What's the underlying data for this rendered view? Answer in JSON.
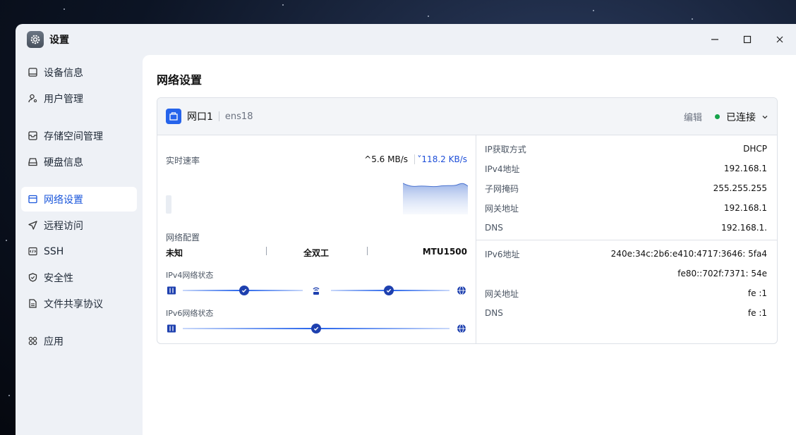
{
  "window": {
    "title": "设置",
    "icon": "gear-icon"
  },
  "window_controls": [
    {
      "name": "minimize-button",
      "icon": "minimize-icon"
    },
    {
      "name": "maximize-button",
      "icon": "maximize-icon"
    },
    {
      "name": "close-button",
      "icon": "close-icon"
    }
  ],
  "sidebar": {
    "items": [
      {
        "label": "设备信息",
        "icon": "device-info-icon",
        "active": false
      },
      {
        "label": "用户管理",
        "icon": "user-icon",
        "active": false
      },
      {
        "label": "存储空间管理",
        "icon": "storage-icon",
        "active": false
      },
      {
        "label": "硬盘信息",
        "icon": "disk-icon",
        "active": false
      },
      {
        "label": "网络设置",
        "icon": "network-icon",
        "active": true
      },
      {
        "label": "远程访问",
        "icon": "remote-access-icon",
        "active": false
      },
      {
        "label": "SSH",
        "icon": "ssh-icon",
        "active": false
      },
      {
        "label": "安全性",
        "icon": "shield-icon",
        "active": false
      },
      {
        "label": "文件共享协议",
        "icon": "file-share-icon",
        "active": false
      },
      {
        "label": "应用",
        "icon": "apps-icon",
        "active": false
      }
    ]
  },
  "page": {
    "title": "网络设置"
  },
  "card": {
    "port_name": "网口1",
    "interface": "ens18",
    "edit_label": "编辑",
    "status_label": "已连接",
    "status_color": "#16a34a",
    "speed": {
      "label": "实时速率",
      "upload": "^5.6 MB/s",
      "download": "˅118.2 KB/s"
    },
    "net_config": {
      "label": "网络配置",
      "speed": "未知",
      "duplex": "全双工",
      "mtu": "MTU1500"
    },
    "ipv4_status": {
      "label": "IPv4网络状态"
    },
    "ipv6_status": {
      "label": "IPv6网络状态"
    },
    "ipv4": [
      {
        "key": "IP获取方式",
        "value": "DHCP"
      },
      {
        "key": "IPv4地址",
        "value": "192.168.1"
      },
      {
        "key": "子网掩码",
        "value": "255.255.255"
      },
      {
        "key": "网关地址",
        "value": "192.168.1"
      },
      {
        "key": "DNS",
        "value": "192.168.1."
      }
    ],
    "ipv6": [
      {
        "key": "IPv6地址",
        "value": "240e:34c:2b6:e410:4717:3646:   5fa4"
      },
      {
        "key": "",
        "value": "fe80::702f:7371:   54e"
      },
      {
        "key": "网关地址",
        "value": "fe  :1"
      },
      {
        "key": "DNS",
        "value": "fe  :1"
      }
    ]
  },
  "colors": {
    "accent": "#1a56db",
    "connected": "#16a34a"
  }
}
